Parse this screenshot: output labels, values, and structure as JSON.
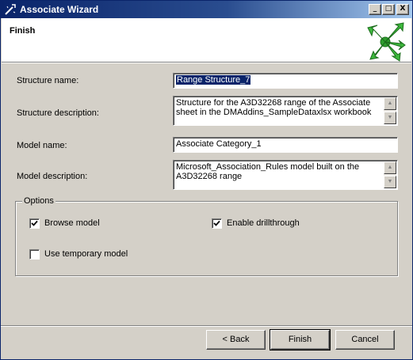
{
  "window": {
    "title": "Associate Wizard",
    "controls": {
      "minimize": "_",
      "maximize": "□",
      "close": "X"
    }
  },
  "header": {
    "title": "Finish",
    "icon": "wizard-arrows-icon"
  },
  "form": {
    "structure_name": {
      "label": "Structure name:",
      "value": "Range Structure_7"
    },
    "structure_description": {
      "label": "Structure description:",
      "value": "Structure for the A3D32268 range of the Associate sheet in the DMAddins_SampleDataxlsx workbook"
    },
    "model_name": {
      "label": "Model name:",
      "value": "Associate Category_1"
    },
    "model_description": {
      "label": "Model description:",
      "value": "Microsoft_Association_Rules model built on the A3D32268 range"
    }
  },
  "options": {
    "legend": "Options",
    "browse_model": {
      "label": "Browse model",
      "checked": true
    },
    "enable_drillthrough": {
      "label": "Enable drillthrough",
      "checked": true
    },
    "use_temporary_model": {
      "label": "Use temporary model",
      "checked": false
    }
  },
  "buttons": {
    "back": "< Back",
    "finish": "Finish",
    "cancel": "Cancel"
  },
  "colors": {
    "titlebar": "#0a246a",
    "face": "#d4d0c8",
    "icon_green": "#2e9e2e"
  }
}
